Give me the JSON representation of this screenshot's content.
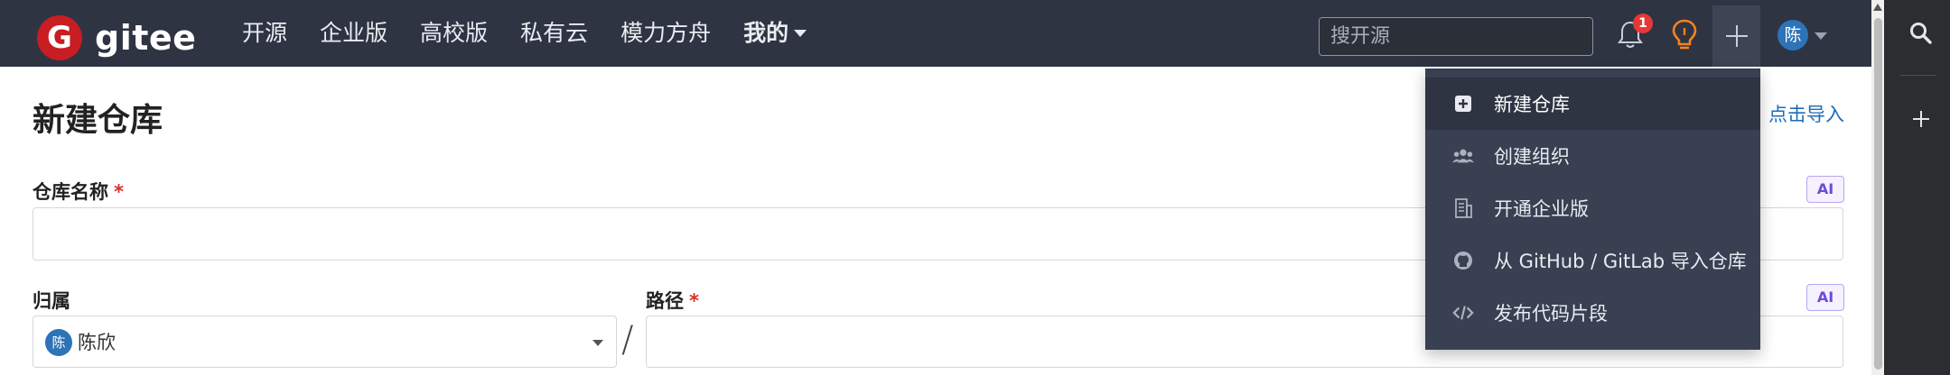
{
  "logo": {
    "text": "gitee",
    "mark": "G"
  },
  "nav": {
    "items": [
      "开源",
      "企业版",
      "高校版",
      "私有云",
      "模力方舟"
    ],
    "mine_label": "我的"
  },
  "search": {
    "placeholder": "搜开源"
  },
  "notifications": {
    "count": "1"
  },
  "user": {
    "avatar_char": "陈"
  },
  "dropdown": {
    "items": [
      {
        "label": "新建仓库",
        "icon": "plus-square-icon"
      },
      {
        "label": "创建组织",
        "icon": "users-icon"
      },
      {
        "label": "开通企业版",
        "icon": "building-icon"
      },
      {
        "label": "从 GitHub / GitLab 导入仓库",
        "icon": "github-icon"
      },
      {
        "label": "发布代码片段",
        "icon": "code-icon"
      }
    ]
  },
  "page": {
    "title": "新建仓库",
    "import_link": "点击导入"
  },
  "form": {
    "repo_name_label": "仓库名称",
    "required_mark": "*",
    "ai_badge": "AI",
    "owner_label": "归属",
    "owner_value": "陈欣",
    "owner_avatar": "陈",
    "path_label": "路径",
    "separator": "/"
  },
  "colors": {
    "topbar": "#2e3442",
    "brand_red": "#c71d23",
    "dropdown_bg": "#384052",
    "link": "#1e6bb8",
    "required": "#d93025"
  }
}
